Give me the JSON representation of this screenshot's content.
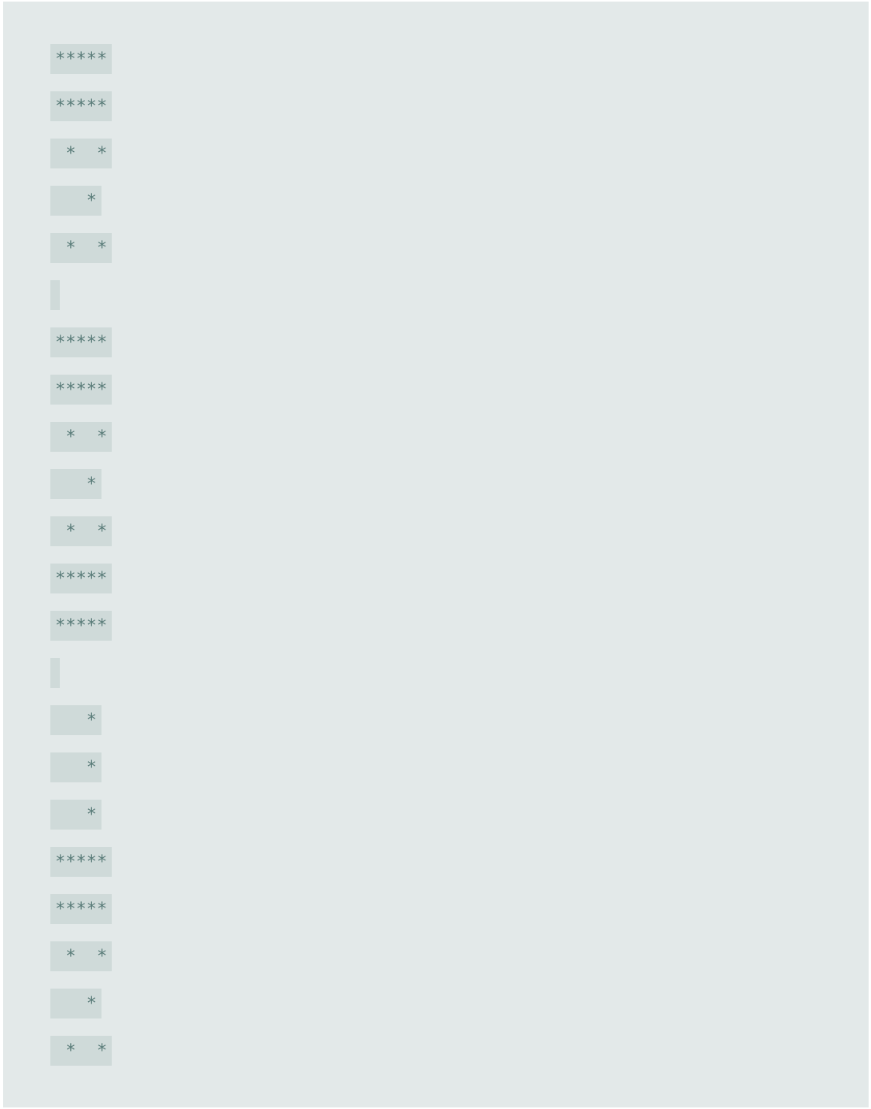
{
  "output": {
    "lines": [
      "*****",
      "*****",
      " *  *",
      "   *",
      " *  *",
      "",
      "*****",
      "*****",
      " *  *",
      "   *",
      " *  *",
      "*****",
      "*****",
      "",
      "   *",
      "   *",
      "   *",
      "*****",
      "*****",
      " *  *",
      "   *",
      " *  *"
    ]
  },
  "colors": {
    "page_background": "#e3e9e9",
    "line_highlight": "#cfdad9",
    "text": "#5a7c79"
  }
}
